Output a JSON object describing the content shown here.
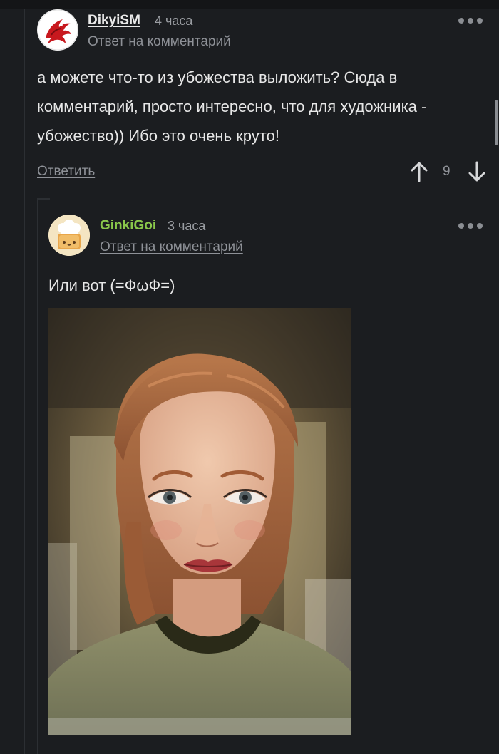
{
  "comments": [
    {
      "username": "DikyiSM",
      "time": "4 часа",
      "reply_link": "Ответ на комментарий",
      "lines": [
        "а можете что-то из убожества выложить? Сюда в",
        "комментарий, просто интересно, что для художника -",
        "убожество)) Ибо это очень круто!"
      ],
      "answer_label": "Ответить",
      "rating": "9",
      "avatar_icon": "red-dragon-icon"
    },
    {
      "username": "GinkiGoi",
      "time": "3 часа",
      "reply_link": "Ответ на комментарий",
      "text": "Или вот (=ФωФ=)",
      "avatar_icon": "chef-hat-toast-icon",
      "image": "painted-portrait-of-red-haired-woman"
    }
  ],
  "colors": {
    "background": "#1b1d20",
    "username_highlight": "#8ac84b",
    "muted": "#8e9197"
  }
}
